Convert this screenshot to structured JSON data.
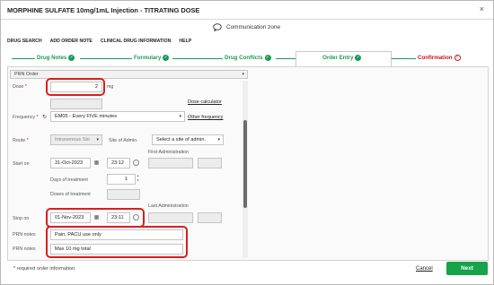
{
  "dialog": {
    "title": "MORPHINE SULFATE 10mg/1mL Injection - TITRATING DOSE",
    "close": "×",
    "communication_zone": "Communication zone"
  },
  "menu": [
    "DRUG SEARCH",
    "ADD ORDER NOTE",
    "CLINICAL DRUG INFORMATION",
    "HELP"
  ],
  "steps": [
    {
      "label": "Drug Notes",
      "status": "done"
    },
    {
      "label": "Formulary",
      "status": "done"
    },
    {
      "label": "Drug Conflicts",
      "status": "done"
    },
    {
      "label": "Order Entry",
      "status": "active"
    },
    {
      "label": "Confirmation",
      "status": "warning"
    }
  ],
  "form": {
    "prn_order": "PRN Order",
    "dose_label": "Dose",
    "required_marker": "*",
    "dose_value": "2",
    "dose_unit": "mg",
    "dose_calculator": "Dose calculator",
    "frequency_label": "Frequency",
    "frequency_value": "EM05 - Every FIVE minutes",
    "other_frequency": "Other frequency",
    "route_label": "Route",
    "route_value": "Intravenous Slo",
    "site_label": "Site of Admin.",
    "site_value": "Select a site of admin.",
    "first_admin_label": "First Administration",
    "start_on_label": "Start on",
    "start_date": "31-Oct-2023",
    "start_time": "23:12",
    "days_label": "Days of treatment",
    "days_value": "1",
    "doses_label": "Doses of treatment",
    "last_admin_label": "Last Administration",
    "stop_on_label": "Stop on",
    "stop_date": "01-Nov-2023",
    "stop_time": "23:11",
    "prn_notes_label": "PRN notes",
    "prn_note_1": "Pain, PACU use only",
    "prn_note_2": "Max 10 mg total"
  },
  "footer": {
    "note": "* required order information.",
    "cancel": "Cancel",
    "next": "Next"
  },
  "colors": {
    "accent_green": "#1a9a55",
    "next_button": "#16a34a",
    "warning_red": "#c4161c",
    "highlight_red": "#d91e1e"
  },
  "icons": {
    "refresh": "refresh-icon",
    "calendar": "calendar-icon",
    "clock": "clock-icon",
    "chat": "chat-bubble-icon"
  }
}
